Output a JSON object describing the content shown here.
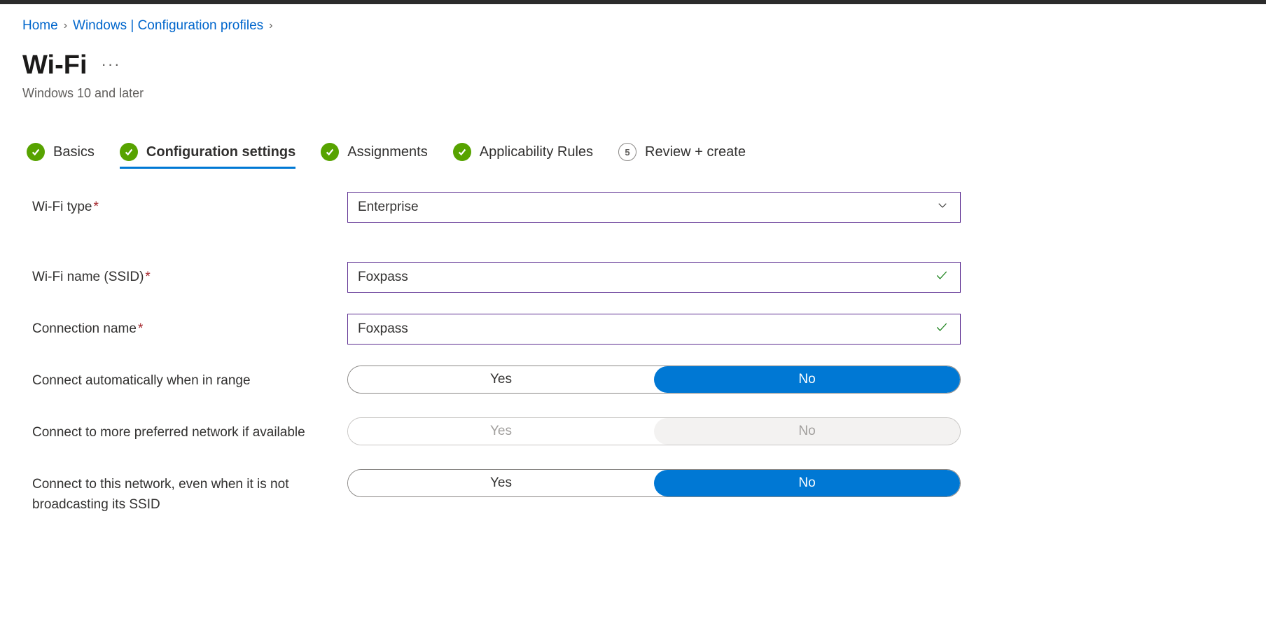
{
  "breadcrumb": {
    "home": "Home",
    "windows": "Windows | Configuration profiles"
  },
  "header": {
    "title": "Wi-Fi",
    "subtitle": "Windows 10 and later"
  },
  "steps": [
    {
      "label": "Basics",
      "status": "done"
    },
    {
      "label": "Configuration settings",
      "status": "done",
      "active": true
    },
    {
      "label": "Assignments",
      "status": "done"
    },
    {
      "label": "Applicability Rules",
      "status": "done"
    },
    {
      "label": "Review + create",
      "status": "num",
      "number": "5"
    }
  ],
  "form": {
    "wifi_type": {
      "label": "Wi-Fi type",
      "value": "Enterprise",
      "required": true
    },
    "ssid": {
      "label": "Wi-Fi name (SSID)",
      "value": "Foxpass",
      "required": true
    },
    "conn_name": {
      "label": "Connection name",
      "value": "Foxpass",
      "required": true
    },
    "auto_connect": {
      "label": "Connect automatically when in range",
      "yes": "Yes",
      "no": "No",
      "selected": "no",
      "disabled": false
    },
    "preferred": {
      "label": "Connect to more preferred network if available",
      "yes": "Yes",
      "no": "No",
      "selected": "no",
      "disabled": true
    },
    "hidden_ssid": {
      "label": "Connect to this network, even when it is not broadcasting its SSID",
      "yes": "Yes",
      "no": "No",
      "selected": "no",
      "disabled": false
    }
  }
}
